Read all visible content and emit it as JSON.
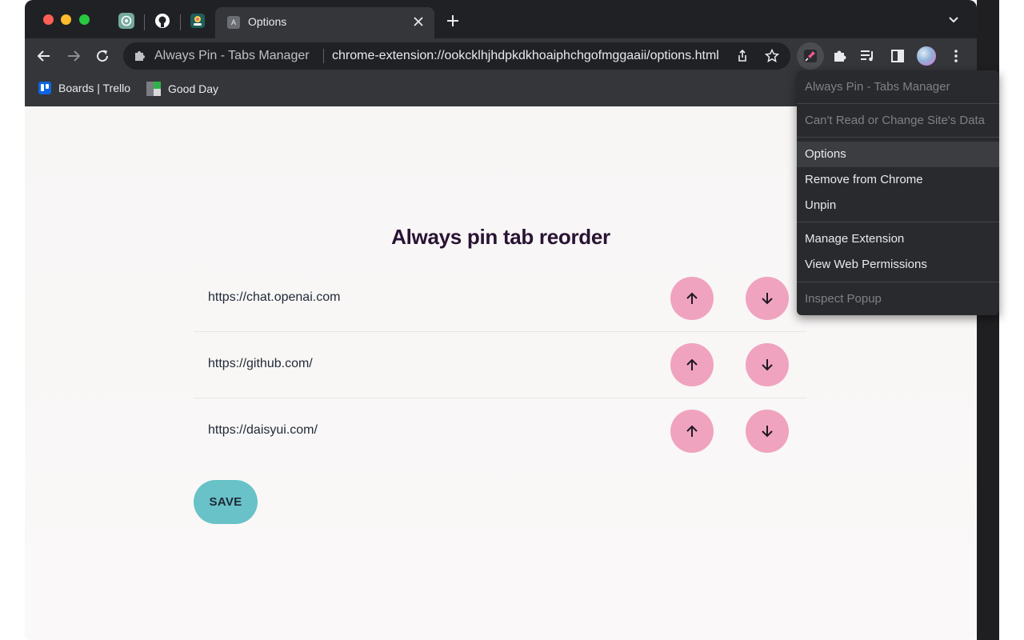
{
  "browser": {
    "tab_title": "Options",
    "tab_favicon_letter": "A",
    "omnibox": {
      "extension_name": "Always Pin - Tabs Manager",
      "url": "chrome-extension://ookcklhjhdpkdkhoaiphchgofmggaaii/options.html"
    },
    "bookmarks": [
      {
        "label": "Boards | Trello",
        "icon": "trello-icon"
      },
      {
        "label": "Good Day",
        "icon": "goodday-icon"
      }
    ]
  },
  "page": {
    "title": "Always pin tab reorder",
    "items": [
      {
        "url": "https://chat.openai.com"
      },
      {
        "url": "https://github.com/"
      },
      {
        "url": "https://daisyui.com/"
      }
    ],
    "save_label": "SAVE"
  },
  "context_menu": {
    "header": "Always Pin - Tabs Manager",
    "site_access": "Can't Read or Change Site's Data",
    "options": "Options",
    "remove": "Remove from Chrome",
    "unpin": "Unpin",
    "manage": "Manage Extension",
    "permissions": "View Web Permissions",
    "inspect": "Inspect Popup"
  },
  "colors": {
    "accent_pink": "#f0a3bf",
    "accent_teal": "#68c2c8",
    "title": "#291334"
  }
}
